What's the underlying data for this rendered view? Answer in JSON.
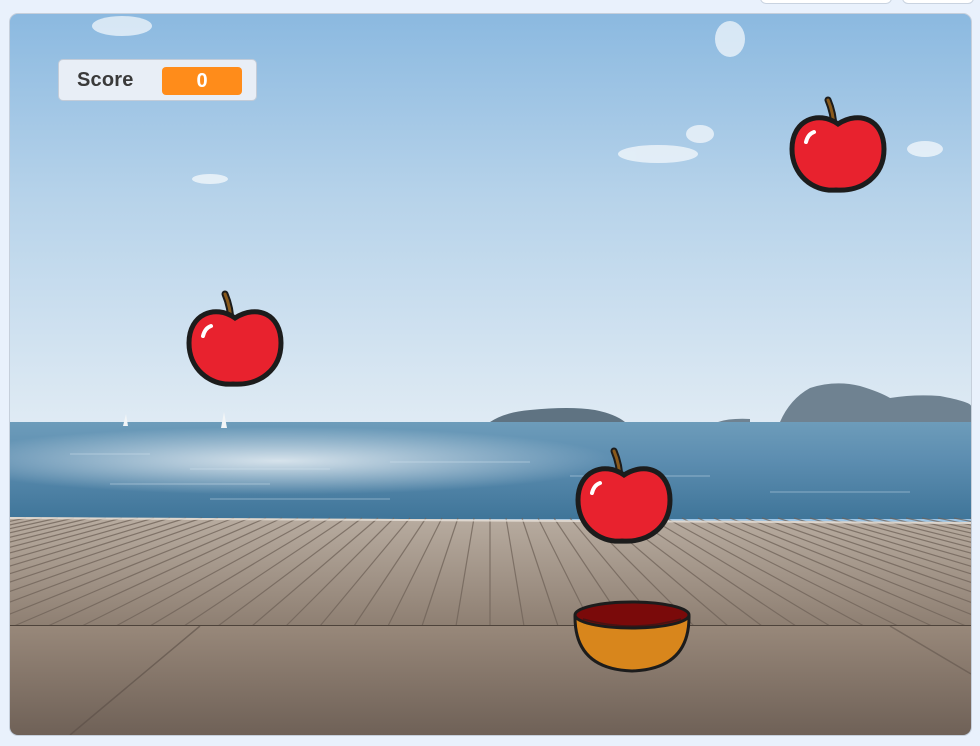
{
  "score": {
    "label": "Score",
    "value": "0"
  },
  "sprites": {
    "apples": [
      {
        "name": "apple-top-right"
      },
      {
        "name": "apple-left"
      },
      {
        "name": "apple-center"
      }
    ],
    "bowl": {
      "name": "bowl"
    }
  },
  "colors": {
    "monitor_value_bg": "#ff8c1a",
    "apple_red": "#e8222e",
    "bowl_orange": "#d8861c",
    "bowl_inner": "#7a0a0a"
  }
}
